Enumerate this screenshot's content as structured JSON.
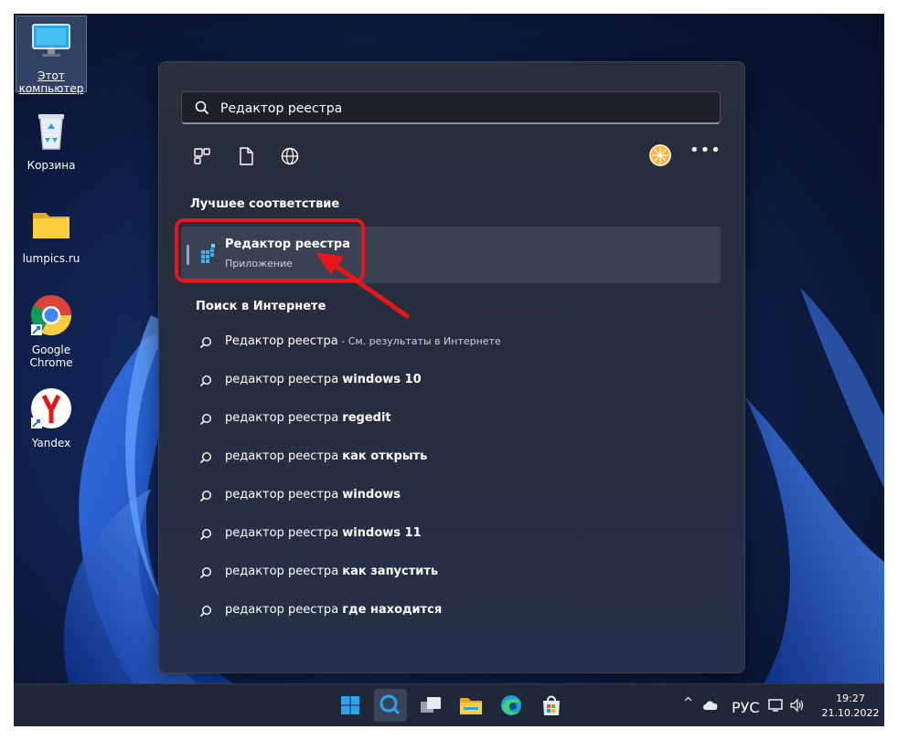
{
  "desktop": {
    "icons": [
      {
        "label": "Этот компьютер",
        "label_line1": "Этот",
        "label_line2": "компьютер",
        "icon": "monitor-icon"
      },
      {
        "label": "Корзина",
        "icon": "recycle-bin-icon"
      },
      {
        "label": "lumpics.ru",
        "icon": "folder-icon"
      },
      {
        "label_line1": "Google",
        "label_line2": "Chrome",
        "icon": "chrome-icon"
      },
      {
        "label": "Yandex",
        "icon": "yandex-icon"
      }
    ]
  },
  "search": {
    "query": "Редактор реестра",
    "filters": [
      "apps-filter-icon",
      "documents-filter-icon",
      "web-filter-icon"
    ],
    "more_label": "•••",
    "best_match_title": "Лучшее соответствие",
    "best_match": {
      "name": "Редактор реестра",
      "kind": "Приложение",
      "icon": "regedit-icon"
    },
    "web_title": "Поиск в Интернете",
    "web_results": [
      {
        "prefix": "Редактор реестра",
        "bold": "",
        "suffix": " - См. результаты в Интернете"
      },
      {
        "prefix": "редактор реестра ",
        "bold": "windows 10",
        "suffix": ""
      },
      {
        "prefix": "редактор реестра ",
        "bold": "regedit",
        "suffix": ""
      },
      {
        "prefix": "редактор реестра ",
        "bold": "как открыть",
        "suffix": ""
      },
      {
        "prefix": "редактор реестра ",
        "bold": "windows",
        "suffix": ""
      },
      {
        "prefix": "редактор реестра ",
        "bold": "windows 11",
        "suffix": ""
      },
      {
        "prefix": "редактор реестра ",
        "bold": "как запустить",
        "suffix": ""
      },
      {
        "prefix": "редактор реестра ",
        "bold": "где находится",
        "suffix": ""
      }
    ]
  },
  "taskbar": {
    "apps": [
      "start-icon",
      "search-icon",
      "task-view-icon",
      "file-explorer-icon",
      "edge-icon",
      "store-icon"
    ],
    "tray": {
      "chevron": "^",
      "language": "РУС"
    },
    "time": "19:27",
    "date": "21.10.2022"
  },
  "colors": {
    "accent": "#0078d4",
    "annotation": "#e8161a",
    "panel": "#262d3d"
  }
}
